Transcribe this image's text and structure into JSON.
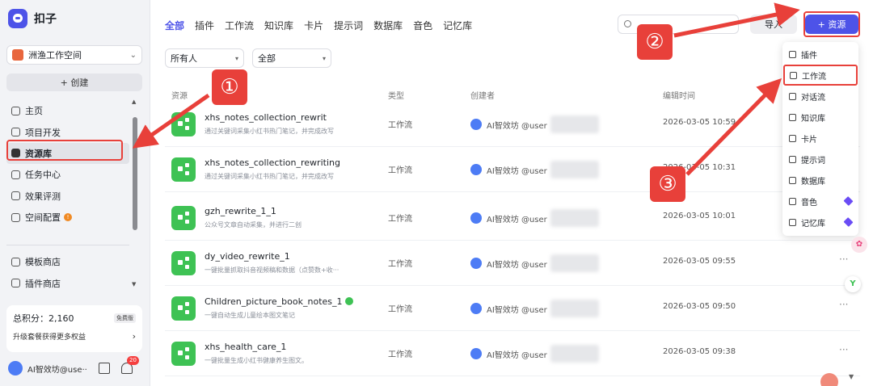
{
  "app": {
    "name": "扣子"
  },
  "sidebar": {
    "workspace": "洲渔工作空间",
    "create_label": "+ 创建",
    "nav": [
      {
        "label": "主页"
      },
      {
        "label": "项目开发"
      },
      {
        "label": "资源库"
      },
      {
        "label": "任务中心"
      },
      {
        "label": "效果评测"
      },
      {
        "label": "空间配置"
      }
    ],
    "nav_store": [
      {
        "label": "模板商店"
      },
      {
        "label": "插件商店"
      }
    ],
    "points_label": "总积分：2,160",
    "plan_badge": "免费版",
    "upgrade_text": "升级套餐获得更多权益",
    "user_name": "AI智效坊@use···",
    "notif_count": "20"
  },
  "main": {
    "tabs": [
      "全部",
      "插件",
      "工作流",
      "知识库",
      "卡片",
      "提示词",
      "数据库",
      "音色",
      "记忆库"
    ],
    "import_label": "导入",
    "resource_btn": "+ 资源",
    "filter_owner": "所有人",
    "filter_type": "全部",
    "columns": {
      "resource": "资源",
      "type": "类型",
      "creator": "创建者",
      "edit_time": "编辑时间"
    },
    "rows": [
      {
        "title": "xhs_notes_collection_rewrit",
        "desc": "通过关键词采集小红书热门笔记，并完成改写",
        "type": "工作流",
        "creator": "AI智效坊 @user",
        "time": "2026-03-05 10:59",
        "verified": false
      },
      {
        "title": "xhs_notes_collection_rewriting",
        "desc": "通过关键词采集小红书热门笔记，并完成改写",
        "type": "工作流",
        "creator": "AI智效坊 @user",
        "time": "2026-03-05 10:31",
        "verified": false
      },
      {
        "title": "gzh_rewrite_1_1",
        "desc": "公众号文章自动采集，并进行二创",
        "type": "工作流",
        "creator": "AI智效坊 @user",
        "time": "2026-03-05 10:01",
        "verified": false
      },
      {
        "title": "dy_video_rewrite_1",
        "desc": "一键批量抓取抖音视频稿和数据（点赞数+收···",
        "type": "工作流",
        "creator": "AI智效坊 @user",
        "time": "2026-03-05 09:55",
        "verified": false
      },
      {
        "title": "Children_picture_book_notes_1",
        "desc": "一键自动生成儿童绘本图文笔记",
        "type": "工作流",
        "creator": "AI智效坊 @user",
        "time": "2026-03-05 09:50",
        "verified": true
      },
      {
        "title": "xhs_health_care_1",
        "desc": "一键批量生成小红书健康养生图文。",
        "type": "工作流",
        "creator": "AI智效坊 @user",
        "time": "2026-03-05 09:38",
        "verified": false
      }
    ],
    "more_glyph": "···"
  },
  "dropdown": {
    "items": [
      {
        "label": "插件"
      },
      {
        "label": "工作流"
      },
      {
        "label": "对话流"
      },
      {
        "label": "知识库"
      },
      {
        "label": "卡片"
      },
      {
        "label": "提示词"
      },
      {
        "label": "数据库"
      },
      {
        "label": "音色"
      },
      {
        "label": "记忆库"
      }
    ]
  },
  "annotations": {
    "callout_1": "①",
    "callout_2": "②",
    "callout_3": "③",
    "color": "#e8403a"
  },
  "theme": {
    "accent": "#4d53e8",
    "workflow_green": "#3ec254"
  }
}
